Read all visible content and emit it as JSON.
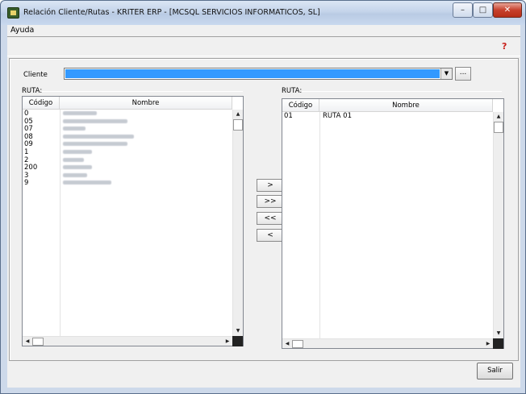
{
  "window": {
    "title": "Relación Cliente/Rutas - KRITER ERP - [MCSQL SERVICIOS INFORMATICOS, SL]",
    "minimize": "–",
    "maximize": "□",
    "close": "✕"
  },
  "menu": {
    "items": [
      {
        "label": "Ayuda"
      }
    ]
  },
  "toolbar": {
    "help_icon": "help-icon"
  },
  "filter": {
    "label": "Cliente",
    "value": "",
    "browse_label": "..."
  },
  "left_list": {
    "group_label": "RUTA:",
    "columns": [
      "Código",
      "Nombre"
    ],
    "rows": [
      {
        "code": "0"
      },
      {
        "code": "05"
      },
      {
        "code": "07"
      },
      {
        "code": "08"
      },
      {
        "code": "09"
      },
      {
        "code": "1"
      },
      {
        "code": "2"
      },
      {
        "code": "200"
      },
      {
        "code": "3"
      },
      {
        "code": "9"
      }
    ]
  },
  "right_list": {
    "group_label": "RUTA:",
    "columns": [
      "Código",
      "Nombre"
    ],
    "rows": [
      {
        "code": "01",
        "name": "RUTA 01"
      }
    ]
  },
  "transfer_buttons": {
    "add_one": ">",
    "add_all": ">>",
    "remove_all": "<<",
    "remove_one": "<"
  },
  "footer": {
    "salir_label": "Salir"
  }
}
